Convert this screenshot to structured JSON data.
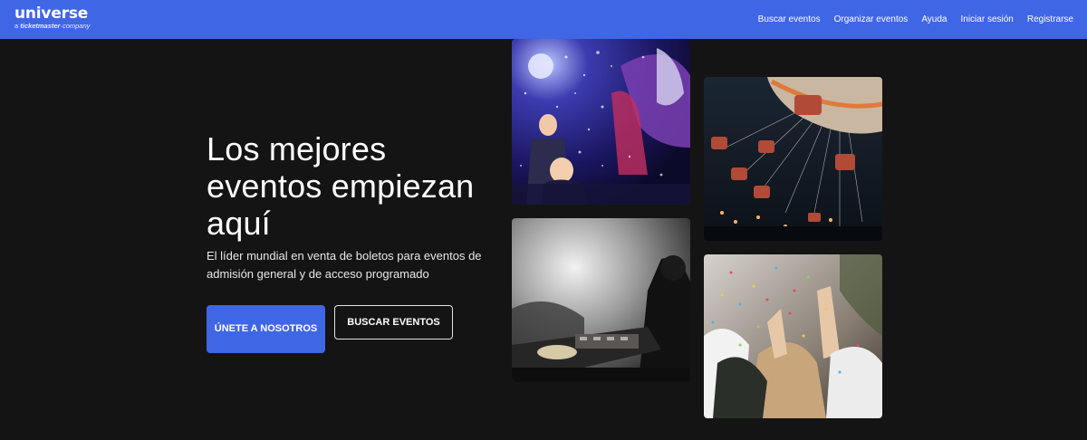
{
  "header": {
    "logo": {
      "word": "universe",
      "sub_prefix": "a",
      "sub_brand": "ticketmaster",
      "sub_suffix": "company"
    },
    "nav": [
      {
        "label": "Buscar eventos"
      },
      {
        "label": "Organizar eventos"
      },
      {
        "label": "Ayuda"
      },
      {
        "label": "Iniciar sesión"
      },
      {
        "label": "Registrarse"
      }
    ]
  },
  "hero": {
    "title": "Los mejores eventos empiezan aquí",
    "subtitle": "El líder mundial en venta de boletos para eventos de admisión general y de acceso programado",
    "primary_button": "ÚNETE A NOSOTROS",
    "secondary_button": "BUSCAR EVENTOS"
  },
  "colors": {
    "brand": "#3f66e5",
    "background": "#141414",
    "text": "#ffffff"
  },
  "gallery": [
    {
      "icon": "concert-bubbles-photo"
    },
    {
      "icon": "swing-ride-photo"
    },
    {
      "icon": "dj-set-photo"
    },
    {
      "icon": "confetti-crowd-photo"
    }
  ]
}
